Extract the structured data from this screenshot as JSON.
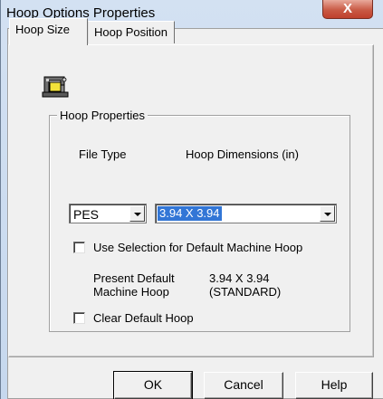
{
  "window": {
    "title": "Hoop Options Properties",
    "close_label": "X"
  },
  "tabs": [
    {
      "label": "Hoop Size",
      "active": true
    },
    {
      "label": "Hoop Position",
      "active": false
    }
  ],
  "icon": "sewing-machine-icon",
  "group": {
    "title": "Hoop Properties",
    "file_type_label": "File Type",
    "hoop_dimensions_label": "Hoop Dimensions (in)",
    "file_type_value": "PES",
    "hoop_dimensions_value": "3.94 X 3.94",
    "use_selection_label": "Use Selection for Default Machine Hoop",
    "use_selection_checked": false,
    "present_default_label_1": "Present Default",
    "present_default_label_2": "Machine Hoop",
    "present_default_value_1": "3.94 X 3.94",
    "present_default_value_2": "(STANDARD)",
    "clear_default_label": "Clear Default Hoop",
    "clear_default_checked": false
  },
  "buttons": {
    "ok": "OK",
    "cancel": "Cancel",
    "help": "Help"
  }
}
